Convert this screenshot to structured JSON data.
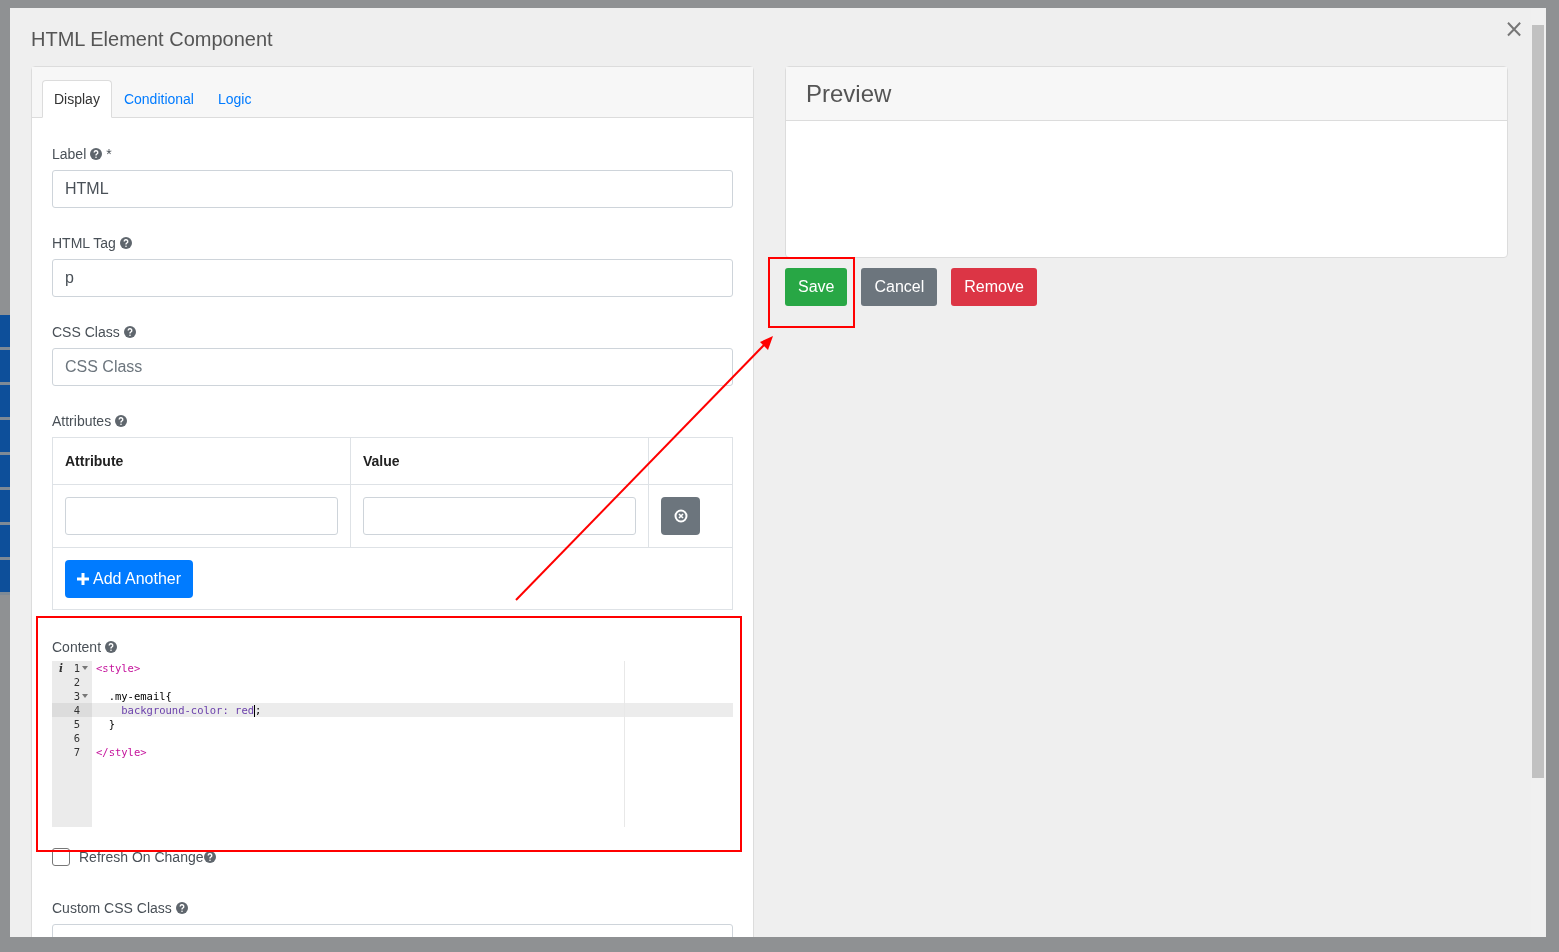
{
  "modal": {
    "title": "HTML Element Component",
    "close": "×"
  },
  "tabs": [
    {
      "label": "Display",
      "selected": true
    },
    {
      "label": "Conditional",
      "selected": false
    },
    {
      "label": "Logic",
      "selected": false
    }
  ],
  "fields": [
    {
      "label": "Label",
      "required_mark": "*",
      "value": "HTML"
    },
    {
      "label": "HTML Tag",
      "value": "p"
    },
    {
      "label": "CSS Class",
      "placeholder": "CSS Class"
    }
  ],
  "attributes": {
    "label": "Attributes",
    "columns": [
      "Attribute",
      "Value"
    ],
    "rows": [
      {
        "kind": "input-row"
      }
    ],
    "add_button": "Add Another"
  },
  "content": {
    "label": "Content",
    "lines": [
      {
        "number": "1",
        "annotation": "i",
        "foldable": true,
        "active": false,
        "tokens": [
          {
            "kind": "tag",
            "text": "<style>"
          }
        ]
      },
      {
        "number": "2",
        "foldable": false,
        "active": false
      },
      {
        "number": "3",
        "foldable": true,
        "active": false,
        "tokens": [
          {
            "kind": "plain",
            "text": "  .my-email{"
          }
        ]
      },
      {
        "number": "4",
        "foldable": false,
        "active": true,
        "tokens": [
          {
            "kind": "property",
            "text": "    background-color: red"
          },
          {
            "kind": "cursor"
          },
          {
            "kind": "plain",
            "text": ";"
          }
        ]
      },
      {
        "number": "5",
        "foldable": false,
        "active": false,
        "tokens": [
          {
            "kind": "plain",
            "text": "  }"
          }
        ]
      },
      {
        "number": "6",
        "foldable": false,
        "active": false
      },
      {
        "number": "7",
        "foldable": false,
        "active": false,
        "tokens": [
          {
            "kind": "tag",
            "text": "</style>"
          }
        ]
      }
    ]
  },
  "refresh_checkbox": {
    "label": "Refresh On Change",
    "checked": false
  },
  "custom_css": {
    "label": "Custom CSS Class"
  },
  "preview": {
    "title": "Preview"
  },
  "buttons": [
    {
      "label": "Save",
      "kind": "success"
    },
    {
      "label": "Cancel",
      "kind": "secondary"
    },
    {
      "label": "Remove",
      "kind": "danger"
    }
  ]
}
